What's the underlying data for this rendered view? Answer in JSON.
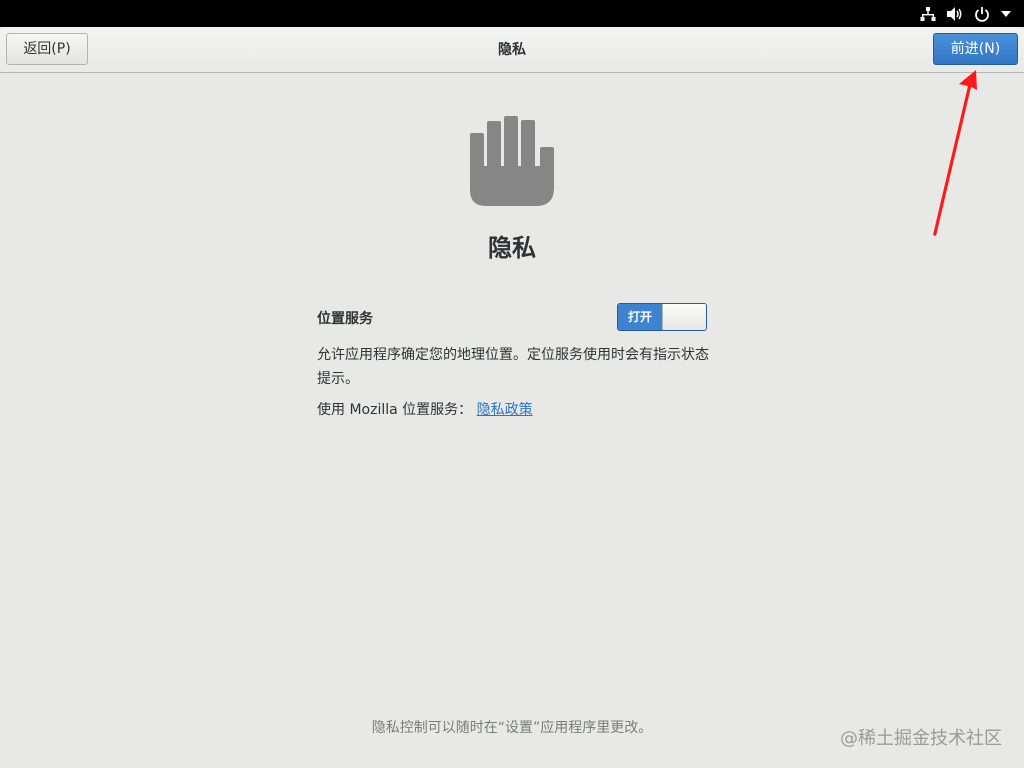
{
  "system_tray": {
    "icons": [
      "network-icon",
      "volume-icon",
      "power-icon",
      "dropdown-arrow-icon"
    ]
  },
  "header": {
    "back_label": "返回(P)",
    "title": "隐私",
    "next_label": "前进(N)"
  },
  "page": {
    "icon": "hand-stop-icon",
    "title": "隐私",
    "location_label": "位置服务",
    "toggle_on_label": "打开",
    "description": "允许应用程序确定您的地理位置。定位服务使用时会有指示状态提示。",
    "mozilla_prefix": "使用 Mozilla 位置服务：",
    "privacy_link": "隐私政策",
    "footer_note": "隐私控制可以随时在“设置”应用程序里更改。"
  },
  "watermark": "@稀土掘金技术社区",
  "colors": {
    "accent": "#3d83d0",
    "annotation_arrow": "#ff1a1a"
  }
}
